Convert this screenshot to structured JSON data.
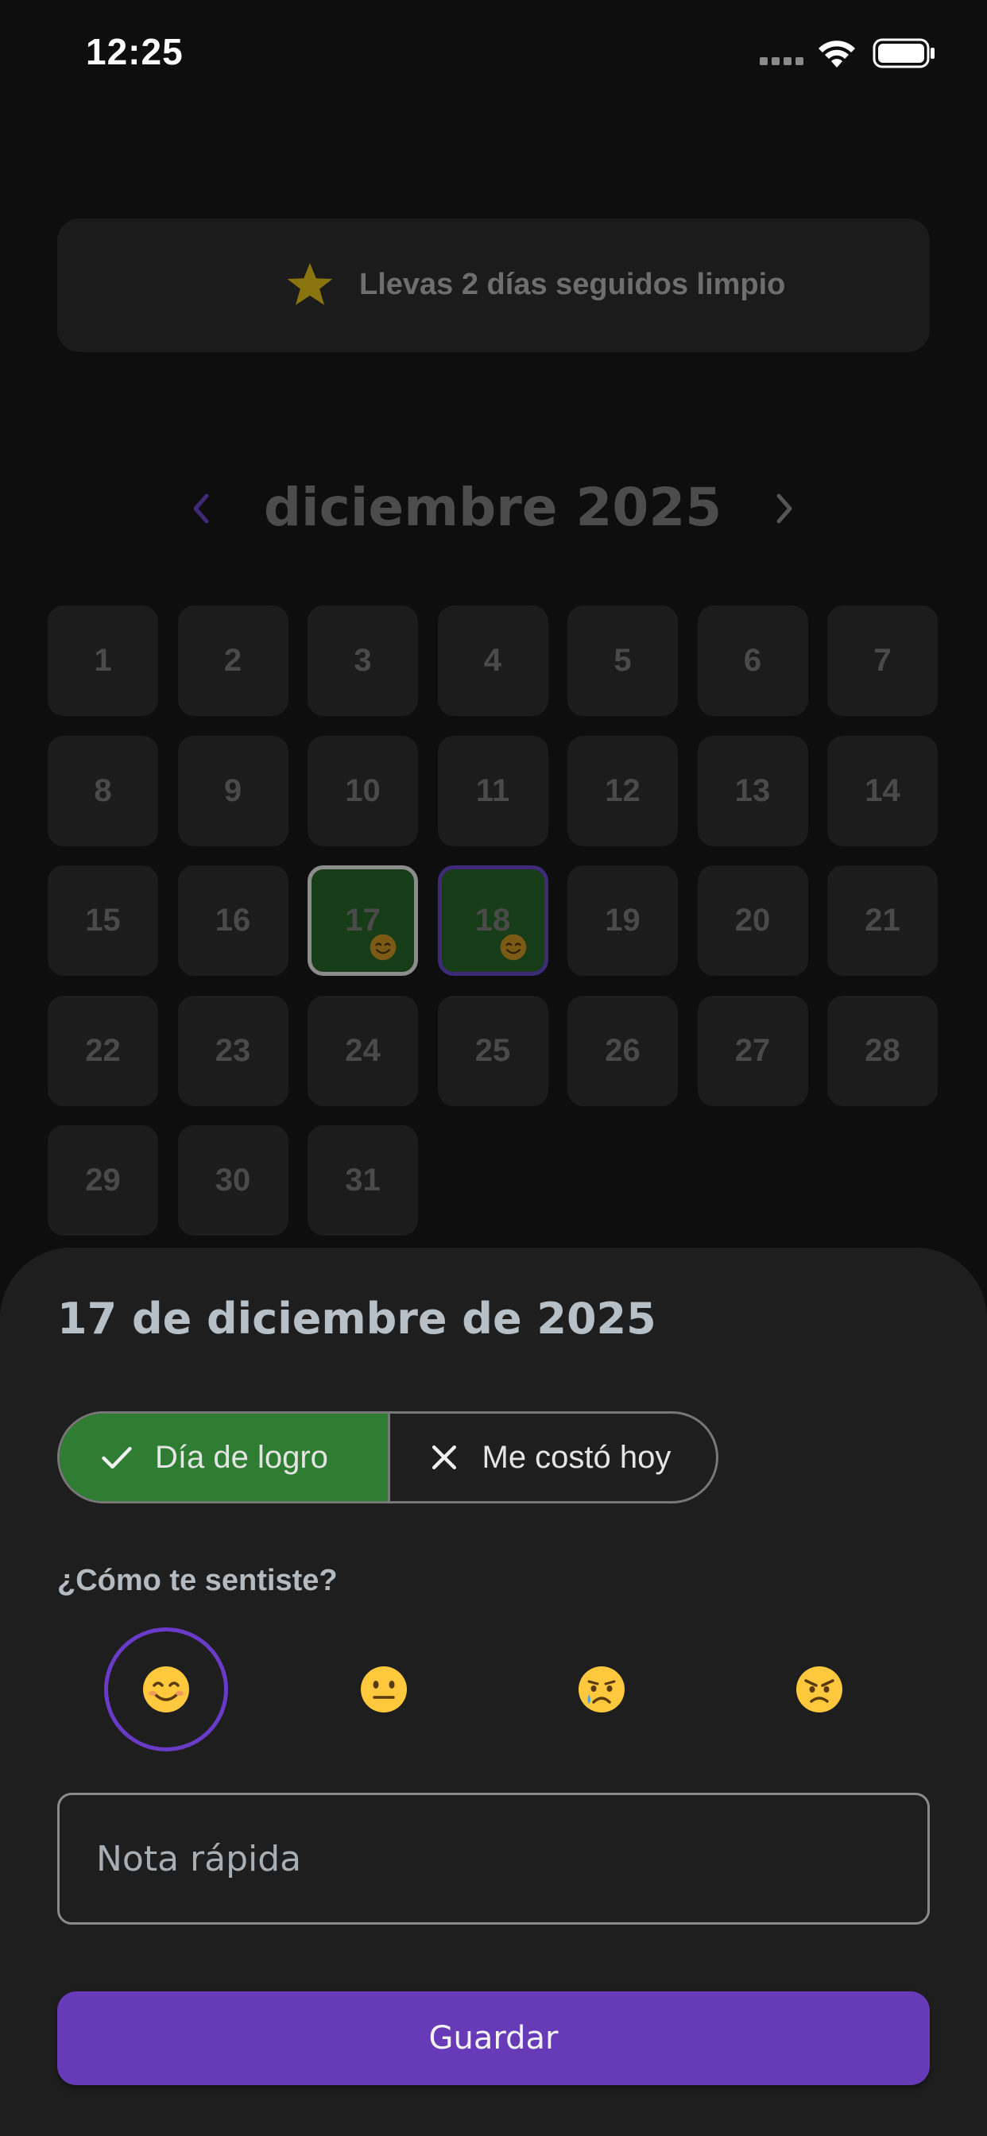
{
  "status_bar": {
    "time": "12:25"
  },
  "streak": {
    "text": "Llevas 2 días seguidos limpio",
    "icon": "star-icon"
  },
  "calendar": {
    "month_title": "diciembre 2025",
    "prev_icon": "chevron-left-icon",
    "next_icon": "chevron-right-icon",
    "days": [
      {
        "label": "1"
      },
      {
        "label": "2"
      },
      {
        "label": "3"
      },
      {
        "label": "4"
      },
      {
        "label": "5"
      },
      {
        "label": "6"
      },
      {
        "label": "7"
      },
      {
        "label": "8"
      },
      {
        "label": "9"
      },
      {
        "label": "10"
      },
      {
        "label": "11"
      },
      {
        "label": "12"
      },
      {
        "label": "13"
      },
      {
        "label": "14"
      },
      {
        "label": "15"
      },
      {
        "label": "16"
      },
      {
        "label": "17",
        "state": "achieved",
        "selected": true,
        "mood": "smile"
      },
      {
        "label": "18",
        "state": "achieved",
        "today": true,
        "mood": "smile"
      },
      {
        "label": "19"
      },
      {
        "label": "20"
      },
      {
        "label": "21"
      },
      {
        "label": "22"
      },
      {
        "label": "23"
      },
      {
        "label": "24"
      },
      {
        "label": "25"
      },
      {
        "label": "26"
      },
      {
        "label": "27"
      },
      {
        "label": "28"
      },
      {
        "label": "29"
      },
      {
        "label": "30"
      },
      {
        "label": "31"
      }
    ]
  },
  "sheet": {
    "title": "17 de diciembre de 2025",
    "toggle": {
      "achieved_label": "Día de logro",
      "hard_label": "Me costó hoy",
      "selected": "achieved"
    },
    "feel_label": "¿Cómo te sentiste?",
    "moods": [
      {
        "name": "smile",
        "selected": true
      },
      {
        "name": "neutral",
        "selected": false
      },
      {
        "name": "sad",
        "selected": false
      },
      {
        "name": "angry",
        "selected": false
      }
    ],
    "note_placeholder": "Nota rápida",
    "save_label": "Guardar"
  },
  "colors": {
    "accent": "#673ab7",
    "achieved": "#2e7d32",
    "achieved_cell": "#163d18",
    "star": "#8a7410"
  }
}
